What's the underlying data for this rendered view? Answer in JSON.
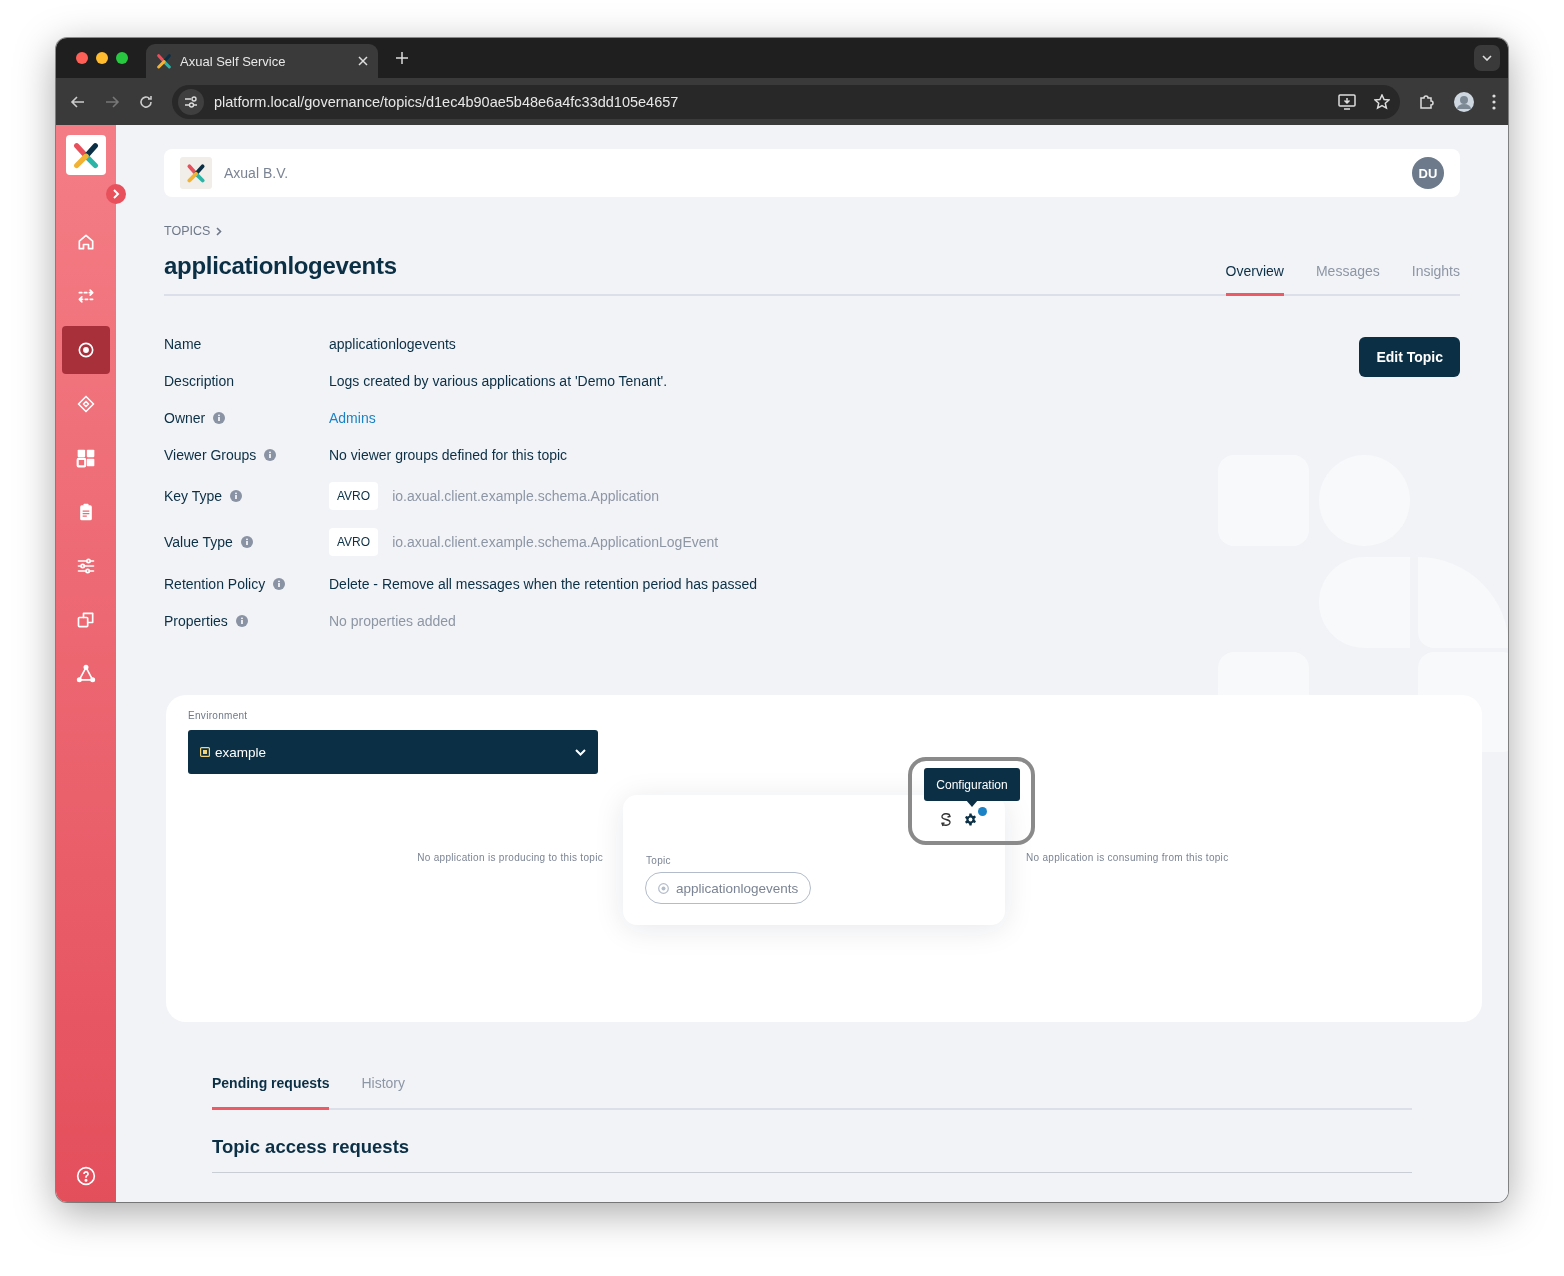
{
  "browser": {
    "tab_title": "Axual Self Service",
    "url": "platform.local/governance/topics/d1ec4b90ae5b48e6a4fc33dd105e4657"
  },
  "sidebar": {
    "items": [
      {
        "kind": "home",
        "selected": false
      },
      {
        "kind": "flows",
        "selected": false
      },
      {
        "kind": "topics",
        "selected": true
      },
      {
        "kind": "diamond",
        "selected": false
      },
      {
        "kind": "grid",
        "selected": false
      },
      {
        "kind": "clipboard",
        "selected": false
      },
      {
        "kind": "sliders",
        "selected": false
      },
      {
        "kind": "copies",
        "selected": false
      },
      {
        "kind": "network",
        "selected": false
      }
    ]
  },
  "header": {
    "organization": "Axual B.V.",
    "avatar": "DU"
  },
  "breadcrumb": [
    "TOPICS"
  ],
  "title": "applicationlogevents",
  "tabs": [
    {
      "label": "Overview",
      "selected": true
    },
    {
      "label": "Messages",
      "selected": false
    },
    {
      "label": "Insights",
      "selected": false
    }
  ],
  "edit_button": "Edit Topic",
  "details": [
    {
      "label": "Name",
      "info": false,
      "kind": "text",
      "value": "applicationlogevents"
    },
    {
      "label": "Description",
      "info": false,
      "kind": "text",
      "value": "Logs created by various applications at 'Demo Tenant'."
    },
    {
      "label": "Owner",
      "info": true,
      "kind": "link",
      "value": "Admins"
    },
    {
      "label": "Viewer Groups",
      "info": true,
      "kind": "text",
      "value": "No viewer groups defined for this topic"
    },
    {
      "label": "Key Type",
      "info": true,
      "kind": "schema",
      "badge": "AVRO",
      "value": "io.axual.client.example.schema.Application"
    },
    {
      "label": "Value Type",
      "info": true,
      "kind": "schema",
      "badge": "AVRO",
      "value": "io.axual.client.example.schema.ApplicationLogEvent"
    },
    {
      "label": "Retention Policy",
      "info": true,
      "kind": "text",
      "value": "Delete - Remove all messages when the retention period has passed"
    },
    {
      "label": "Properties",
      "info": true,
      "kind": "muted",
      "value": "No properties added"
    }
  ],
  "topology": {
    "environment_label": "Environment",
    "environment": "example",
    "producers_empty": "No application is producing to this topic",
    "topic_label": "Topic",
    "topic": "applicationlogevents",
    "consumers_empty": "No application is consuming from this topic",
    "tooltip": "Configuration",
    "config_notification": true
  },
  "requests": {
    "tabs": [
      {
        "label": "Pending requests",
        "selected": true
      },
      {
        "label": "History",
        "selected": false
      }
    ],
    "section_title": "Topic access requests"
  }
}
